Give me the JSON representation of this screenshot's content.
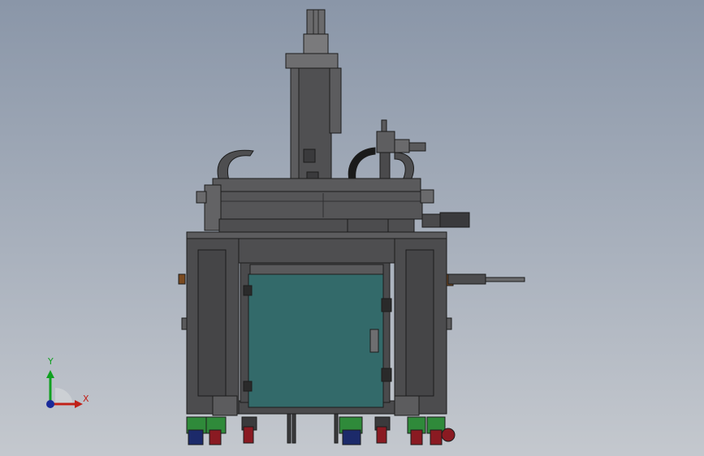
{
  "colors": {
    "background_top": "#8a96a8",
    "background_bottom": "#c4c8ce",
    "frame": "#4c4c4e",
    "frame_edge": "#1c1c1c",
    "door_panel": "#336a6a",
    "caster_green": "#2f8a3a",
    "caster_red": "#8a1a22",
    "caster_blue": "#1c2a6a",
    "axis_x": "#c02018",
    "axis_y": "#10a020",
    "axis_z": "#1a2a9a"
  },
  "triad": {
    "x_label": "X",
    "y_label": "Y"
  }
}
